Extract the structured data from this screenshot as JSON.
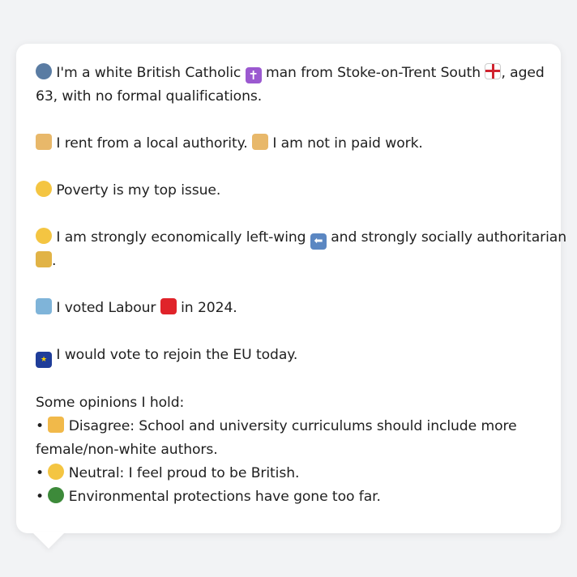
{
  "profile": {
    "intro_l1_a": "I'm a white British Catholic",
    "intro_l1_b": "man from Stoke-on-Trent South",
    "intro_l1_c": ", aged",
    "intro_l2": "63, with no formal qualifications.",
    "housing_a": "I rent from a local authority.",
    "housing_b": "I am not in paid work.",
    "issue": "Poverty is my top issue.",
    "ideology_l1_a": "I am strongly economically left-wing",
    "ideology_l1_b": "and strongly socially authoritarian",
    "ideology_l2": ".",
    "vote_a": "I voted Labour",
    "vote_b": "in 2024.",
    "eu": "I would vote to rejoin the EU today."
  },
  "opinions": {
    "heading": "Some opinions I hold:",
    "bullet": "•",
    "op1_l1": "Disagree: School and university curriculums should include more",
    "op1_l2": "female/non-white authors.",
    "op2": "Neutral: I feel proud to be British.",
    "op3": "Environmental protections have gone too far."
  },
  "icons": {
    "person": "person-silhouette-icon",
    "cross": "latin-cross-icon",
    "england_flag": "england-flag-icon",
    "house": "house-icon",
    "sad": "disappointed-face-icon",
    "thinking": "thinking-face-icon",
    "left_arrow": "left-arrow-icon",
    "lock": "lock-icon",
    "ballot": "ballot-box-icon",
    "labour": "red-square-icon",
    "eu_flag": "eu-flag-icon",
    "thumbs_down": "thumbs-down-icon",
    "neutral": "neutral-face-icon",
    "tree": "tree-icon"
  },
  "colors": {
    "background": "#f2f3f5",
    "bubble": "#ffffff",
    "text": "#1f1f1f",
    "labour_red": "#e0232a"
  }
}
